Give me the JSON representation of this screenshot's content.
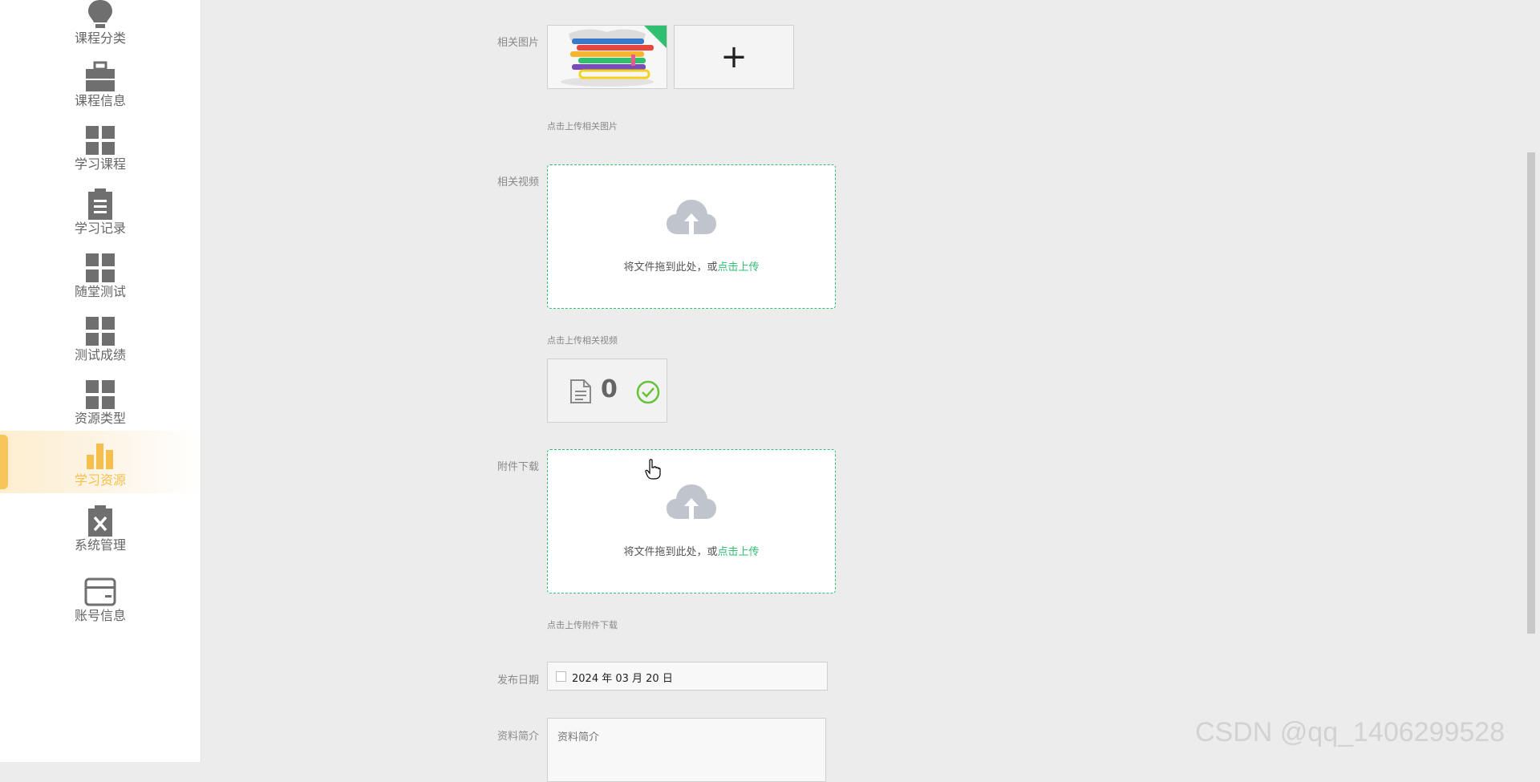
{
  "sidebar": {
    "items": [
      {
        "label": "课程分类",
        "icon": "lightbulb-icon"
      },
      {
        "label": "课程信息",
        "icon": "briefcase-icon"
      },
      {
        "label": "学习课程",
        "icon": "grid-icon"
      },
      {
        "label": "学习记录",
        "icon": "clipboard-icon"
      },
      {
        "label": "随堂测试",
        "icon": "grid-icon"
      },
      {
        "label": "测试成绩",
        "icon": "grid-icon"
      },
      {
        "label": "资源类型",
        "icon": "grid-icon"
      },
      {
        "label": "学习资源",
        "icon": "bar-chart-icon",
        "active": true
      },
      {
        "label": "系统管理",
        "icon": "clipboard-x-icon"
      },
      {
        "label": "账号信息",
        "icon": "card-icon"
      }
    ]
  },
  "form": {
    "image": {
      "label": "相关图片",
      "hint": "点击上传相关图片",
      "add_symbol": "+"
    },
    "video": {
      "label": "相关视频",
      "drop_text": "将文件拖到此处，或",
      "drop_link": "点击上传",
      "hint": "点击上传相关视频",
      "file_count": "0"
    },
    "attachment": {
      "label": "附件下载",
      "drop_text": "将文件拖到此处，或",
      "drop_link": "点击上传",
      "hint": "点击上传附件下载"
    },
    "publish_date": {
      "label": "发布日期",
      "value": "2024 年 03 月 20 日"
    },
    "summary": {
      "label": "资料简介",
      "placeholder": "资料简介"
    }
  },
  "watermark": "CSDN @qq_1406299528",
  "colors": {
    "accent_green": "#2fbf71",
    "active_orange": "#f5bf4c",
    "icon_gray": "#6f6f6f"
  }
}
